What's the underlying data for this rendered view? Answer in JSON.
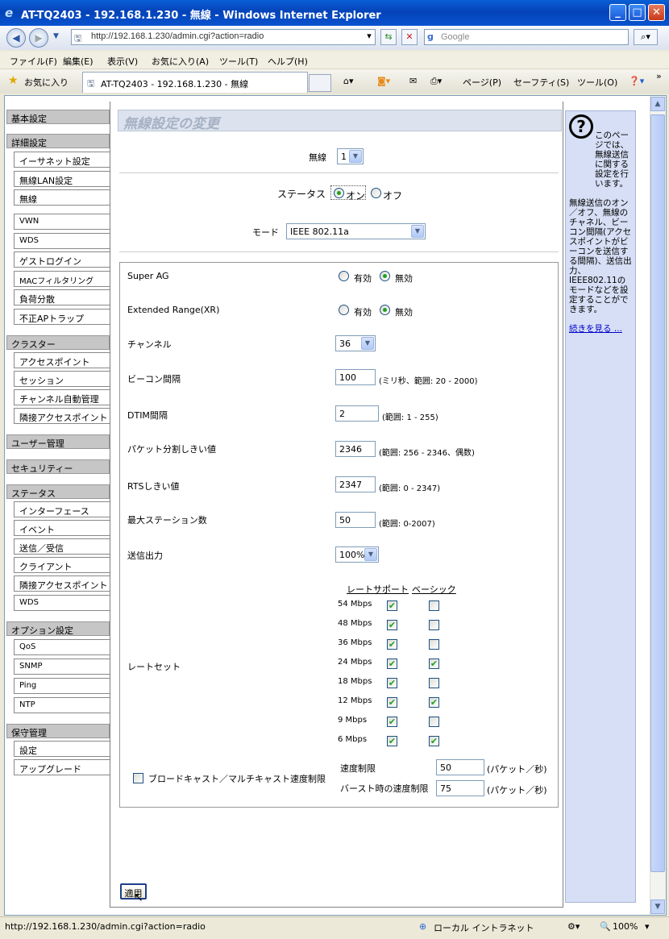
{
  "window": {
    "title": "AT-TQ2403 - 192.168.1.230 - 無線 - Windows Internet Explorer",
    "min": "_",
    "max": "□",
    "close": "✕"
  },
  "address_bar": {
    "url": "http://192.168.1.230/admin.cgi?action=radio",
    "search_placeholder": "Google"
  },
  "menu": [
    "ファイル(F)",
    "編集(E)",
    "表示(V)",
    "お気に入り(A)",
    "ツール(T)",
    "ヘルプ(H)"
  ],
  "favorites": {
    "label": "お気に入り",
    "tab_title": "AT-TQ2403 - 192.168.1.230 - 無線"
  },
  "toolbar": {
    "page": "ページ(P)",
    "safety": "セーフティ(S)",
    "tools": "ツール(O)",
    "more": "»"
  },
  "sidebar": {
    "basic": "基本設定",
    "advanced": "詳細設定",
    "ethernet": "イーサネット設定",
    "wlan": "無線LAN設定",
    "radio": "無線",
    "vwn": "VWN",
    "wds": "WDS",
    "guest": "ゲストログイン",
    "mac": "MACフィルタリング",
    "load": "負荷分散",
    "rogue": "不正APトラップ",
    "cluster": "クラスター",
    "access_points": "アクセスポイント",
    "sessions": "セッション",
    "channel_mgmt": "チャンネル自動管理",
    "neighbor_ap": "隣接アクセスポイント",
    "user_mgmt": "ユーザー管理",
    "security": "セキュリティー",
    "status": "ステータス",
    "interfaces": "インターフェース",
    "events": "イベント",
    "txrx": "送信／受信",
    "clients": "クライアント",
    "neighbor_ap2": "隣接アクセスポイント",
    "wds2": "WDS",
    "options": "オプション設定",
    "qos": "QoS",
    "snmp": "SNMP",
    "ping": "Ping",
    "ntp": "NTP",
    "maintenance": "保守管理",
    "settings": "設定",
    "upgrade": "アップグレード"
  },
  "main": {
    "title": "無線設定の変更",
    "radio_label": "無線",
    "radio_value": "1",
    "status_label": "ステータス",
    "status_on": "オン",
    "status_off": "オフ",
    "mode_label": "モード",
    "mode_value": "IEEE 802.11a",
    "super_ag": "Super AG",
    "xr": "Extended Range(XR)",
    "enable": "有効",
    "disable": "無効",
    "channel_label": "チャンネル",
    "channel_value": "36",
    "beacon_label": "ビーコン間隔",
    "beacon_value": "100",
    "beacon_hint": "(ミリ秒、範囲: 20 - 2000)",
    "dtim_label": "DTIM間隔",
    "dtim_value": "2",
    "dtim_hint": "(範囲: 1 - 255)",
    "frag_label": "パケット分割しきい値",
    "frag_value": "2346",
    "frag_hint": "(範囲: 256 - 2346、偶数)",
    "rts_label": "RTSしきい値",
    "rts_value": "2347",
    "rts_hint": "(範囲: 0 - 2347)",
    "maxsta_label": "最大ステーション数",
    "maxsta_value": "50",
    "maxsta_hint": "(範囲: 0-2007)",
    "power_label": "送信出力",
    "power_value": "100%",
    "rateset_label": "レートセット",
    "rate_headers": [
      "レート",
      "サポート",
      "ベーシック"
    ],
    "rates": [
      {
        "rate": "54 Mbps",
        "supported": true,
        "basic": false
      },
      {
        "rate": "48 Mbps",
        "supported": true,
        "basic": false
      },
      {
        "rate": "36 Mbps",
        "supported": true,
        "basic": false
      },
      {
        "rate": "24 Mbps",
        "supported": true,
        "basic": true
      },
      {
        "rate": "18 Mbps",
        "supported": true,
        "basic": false
      },
      {
        "rate": "12 Mbps",
        "supported": true,
        "basic": true
      },
      {
        "rate": "9 Mbps",
        "supported": true,
        "basic": false
      },
      {
        "rate": "6 Mbps",
        "supported": true,
        "basic": true
      }
    ],
    "bcast_label": "ブロードキャスト／マルチキャスト速度制限",
    "rate_limit_label": "速度制限",
    "rate_limit_value": "50",
    "burst_label": "バースト時の速度制限",
    "burst_value": "75",
    "pps": "(パケット／秒)",
    "apply": "適用"
  },
  "help": {
    "text1": "このページでは、無線送信に関する設定を行います。",
    "text2": "無線送信のオン／オフ、無線のチャネル、ビーコン間隔(アクセスポイントがビーコンを送信する間隔)、送信出力、IEEE802.11のモードなどを設定することができます。",
    "more": "続きを見る ..."
  },
  "status_bar": {
    "url": "http://192.168.1.230/admin.cgi?action=radio",
    "zone": "ローカル イントラネット",
    "zoom": "100%"
  }
}
